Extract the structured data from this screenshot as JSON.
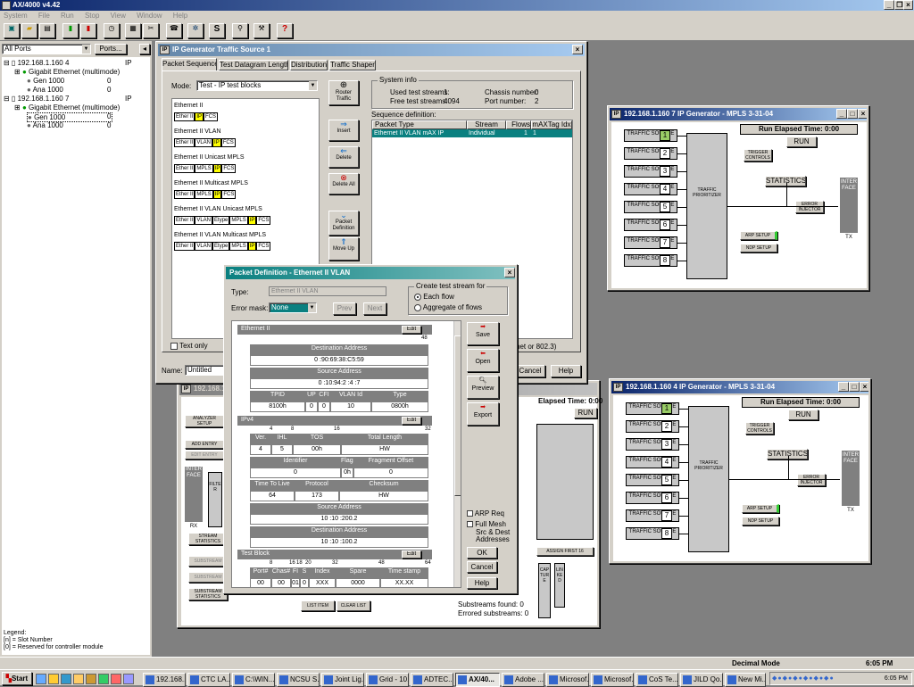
{
  "app": {
    "title": "AX/4000 v4.42",
    "menu": [
      "System",
      "File",
      "Run",
      "Stop",
      "View",
      "Window",
      "Help"
    ]
  },
  "left_panel": {
    "ports_select": "All Ports",
    "ports_button": "Ports...",
    "tree": [
      {
        "label": "192.168.1.160 4",
        "tag": "IP"
      },
      {
        "label": "Gigabit Ethernet (multimode)"
      },
      {
        "label": "Gen 1000",
        "value": "0"
      },
      {
        "label": "Ana 1000",
        "value": "0"
      },
      {
        "label": "192.168.1.160 7",
        "tag": "IP"
      },
      {
        "label": "Gigabit Ethernet (multimode)"
      },
      {
        "label": "Gen 1000",
        "value": "0"
      },
      {
        "label": "Ana 1000",
        "value": "0"
      }
    ],
    "legend": [
      "Legend:",
      "[n] = Slot Number",
      "[0] = Reserved for controller module"
    ]
  },
  "traffic_window": {
    "title": "IP Generator Traffic Source 1",
    "tabs": [
      "Packet Sequence",
      "Test Datagram Length",
      "Distribution",
      "Traffic Shaper"
    ],
    "mode_label": "Mode:",
    "mode_value": "Test - IP test blocks",
    "packet_types": [
      {
        "name": "Ethernet II",
        "fields": [
          "Ether II",
          "IP",
          "FCS"
        ]
      },
      {
        "name": "Ethernet II VLAN",
        "fields": [
          "Ether II",
          "VLAN",
          "IP",
          "FCS"
        ]
      },
      {
        "name": "Ethernet II Unicast MPLS",
        "fields": [
          "Ether II",
          "MPLS",
          "IP",
          "FCS"
        ]
      },
      {
        "name": "Ethernet II Multicast MPLS",
        "fields": [
          "Ether II",
          "MPLS",
          "IP",
          "FCS"
        ]
      },
      {
        "name": "Ethernet II VLAN Unicast MPLS",
        "fields": [
          "Ether II",
          "VLAN",
          "Etype",
          "MPLS",
          "IP",
          "FCS"
        ]
      },
      {
        "name": "Ethernet II VLAN Multicast MPLS",
        "fields": [
          "Ether II",
          "VLAN",
          "Etype",
          "MPLS",
          "IP",
          "FCS"
        ]
      }
    ],
    "buttons": [
      "Router Traffic",
      "Insert",
      "Delete",
      "Delete All",
      "Packet Definition",
      "Move Up"
    ],
    "sysinfo": {
      "title": "System info",
      "used_label": "Used test streams:",
      "used": "1",
      "free_label": "Free test streams:",
      "free": "4094",
      "chassis_label": "Chassis number:",
      "chassis": "0",
      "port_label": "Port number:",
      "port": "2"
    },
    "seq_label": "Sequence definition:",
    "seq_headers": [
      "Packet Type",
      "Stream",
      "Flows",
      "mAXTag Idx"
    ],
    "seq_row": [
      "Ethernet II VLAN mAX IP",
      "Individual",
      "1",
      "1"
    ],
    "text_only": "Text only",
    "name_label": "Name:",
    "name_value": "Untitled",
    "frag_text": "het or 802.3)",
    "cancel": "Cancel",
    "help": "Help"
  },
  "gen7": {
    "title": "192.168.1.160 7 IP Generator - MPLS 3-31-04",
    "elapsed": "Run Elapsed Time: 0:00",
    "run": "RUN",
    "trigger": "TRIGGER CONTROLS",
    "statistics": "STATISTICS",
    "error_injector": "ERROR INJECTOR",
    "interface": "INTERFACE",
    "tx": "TX",
    "prioritizer": "TRAFFIC PRIORITIZER",
    "arp": "ARP SETUP",
    "ndp": "NDP SETUP",
    "sources": [
      "1",
      "2",
      "3",
      "4",
      "5",
      "6",
      "7",
      "8"
    ],
    "source_label": "TRAFFIC SOURCE"
  },
  "gen4": {
    "title": "192.168.1.160 4 IP Generator - MPLS 3-31-04",
    "elapsed": "Run Elapsed Time: 0:00",
    "run": "RUN",
    "trigger": "TRIGGER CONTROLS",
    "statistics": "STATISTICS",
    "error_injector": "ERROR INJECTOR",
    "interface": "INTERFACE",
    "tx": "TX",
    "prioritizer": "TRAFFIC PRIORITIZER",
    "arp": "ARP SETUP",
    "ndp": "NDP SETUP",
    "sources": [
      "1",
      "2",
      "3",
      "4",
      "5",
      "6",
      "7",
      "8"
    ],
    "source_label": "TRAFFIC SOURCE"
  },
  "analyzer": {
    "title": "192.168.1.1",
    "elapsed": "Elapsed Time: 0:00",
    "run": "RUN",
    "analyzer_setup": "ANALYZER SETUP",
    "add_entry": "ADD ENTRY",
    "edit_entry": "EDIT ENTRY",
    "stream_stats": "STREAM STATISTICS",
    "substream_a": "SUBSTREAM",
    "substream_b": "SUBSTREAM",
    "substream_stats": "SUBSTREAM STATISTICS",
    "interface": "INTERFACE",
    "rx": "RX",
    "filter": "FILTER",
    "list_item": "LIST ITEM",
    "clear_list": "CLEAR LIST",
    "assign_first": "ASSIGN FIRST 16",
    "capture": "CAPTURE",
    "linked": "LINKED",
    "found": "Substreams found: 0",
    "errored": "Errored substreams: 0"
  },
  "packet_def": {
    "title": "Packet Definition - Ethernet II VLAN",
    "type_label": "Type:",
    "type_value": "Ethernet II VLAN",
    "error_label": "Error mask:",
    "error_value": "None",
    "prev": "Prev",
    "next": "Next",
    "create_title": "Create test stream for",
    "each": "Each flow",
    "aggregate": "Aggregate of flows",
    "eth_header": "Ethernet II",
    "edit": "Edit",
    "eth_num": "48",
    "dest_label": "Destination Address",
    "dest": "0 :90:69:38:C5:59",
    "src_label": "Source Address",
    "src": "0 :10:94:2 :4 :7",
    "vlan_headers": [
      "TPID",
      "UP",
      "CFI",
      "VLAN Id",
      "Type"
    ],
    "vlan_values": [
      "8100h",
      "0",
      "0",
      "10",
      "0800h"
    ],
    "ipv4_header": "IPv4",
    "ipv4_ruler": [
      "4",
      "8",
      "16",
      "32"
    ],
    "ip_r1h": [
      "Ver.",
      "IHL",
      "TOS",
      "Total Length"
    ],
    "ip_r1v": [
      "4",
      "5",
      "00h",
      "HW"
    ],
    "ip_r2h": [
      "Identifier",
      "Flags",
      "Fragment Offset"
    ],
    "ip_r2v": [
      "0",
      "0h",
      "0"
    ],
    "ip_r3h": [
      "Time To Live",
      "Protocol",
      "Checksum"
    ],
    "ip_r3v": [
      "64",
      "173",
      "HW"
    ],
    "ip_src_label": "Source Address",
    "ip_src": "10 :10 :200.2",
    "ip_dst_label": "Destination Address",
    "ip_dst": "10 :10 :100.2",
    "tb_header": "Test Block",
    "tb_ruler": [
      "8",
      "16",
      "18",
      "20",
      "32",
      "48",
      "64"
    ],
    "tb_h": [
      "Port#",
      "Chas#",
      "FI",
      "S",
      "Index",
      "Spare",
      "Time stamp"
    ],
    "tb_v": [
      "00",
      "00",
      "01",
      "0",
      "XXX",
      "0000",
      "XX.XX"
    ],
    "side": [
      "Save",
      "Open",
      "Preview",
      "Export"
    ],
    "arp": "ARP Req",
    "full_mesh": "Full Mesh",
    "src_dest": "Src & Dest Addresses",
    "ok": "OK",
    "cancel": "Cancel",
    "help": "Help"
  },
  "statusbar": {
    "mode": "Decimal Mode",
    "time": "6:05 PM"
  },
  "taskbar": {
    "start": "Start",
    "tasks": [
      "192.168....",
      "CTC LA...",
      "C:\\WIN...",
      "NCSU S...",
      "Joint Lig...",
      "Grid - 10...",
      "ADTEC...",
      "AX/40...",
      "Adobe ...",
      "Microsof...",
      "Microsof...",
      "CoS Te...",
      "JILD Qo...",
      "New Mi..."
    ],
    "clock": "6:05 PM"
  }
}
